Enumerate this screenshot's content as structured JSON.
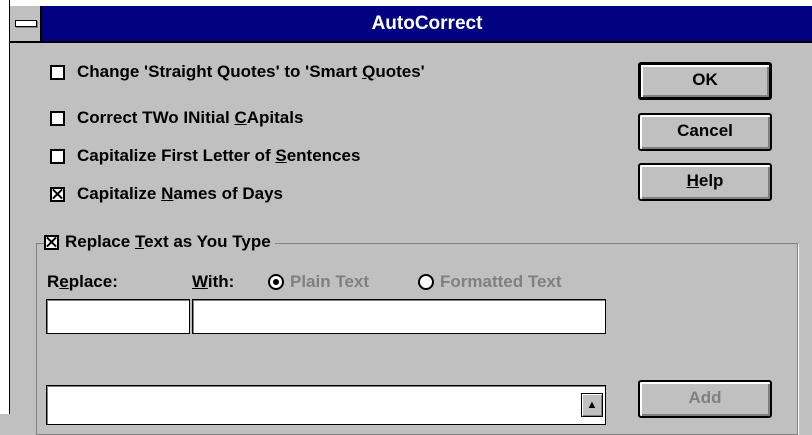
{
  "window": {
    "title": "AutoCorrect"
  },
  "options": [
    {
      "label_pre": "Change 'Straight Quotes' to 'Smart ",
      "label_u": "Q",
      "label_post": "uotes'",
      "checked": false
    },
    {
      "label_pre": "Correct TWo INitial ",
      "label_u": "C",
      "label_post": "Apitals",
      "checked": false
    },
    {
      "label_pre": "Capitalize First Letter of ",
      "label_u": "S",
      "label_post": "entences",
      "checked": false
    },
    {
      "label_pre": "Capitalize ",
      "label_u": "N",
      "label_post": "ames of Days",
      "checked": true
    }
  ],
  "buttons": {
    "ok": "OK",
    "cancel": "Cancel",
    "help_u": "H",
    "help_rest": "elp",
    "add": "Add"
  },
  "replace_group": {
    "label_pre": "Replace ",
    "label_u": "T",
    "label_post": "ext as You Type",
    "checked": true,
    "replace_label_pre": "R",
    "replace_label_u": "e",
    "replace_label_post": "place:",
    "with_label_u": "W",
    "with_label_post": "ith:",
    "radio_plain": "Plain Text",
    "radio_formatted": "Formatted Text",
    "selected_format": "Plain Text",
    "replace_value": "",
    "with_value": "",
    "list_value": ""
  }
}
